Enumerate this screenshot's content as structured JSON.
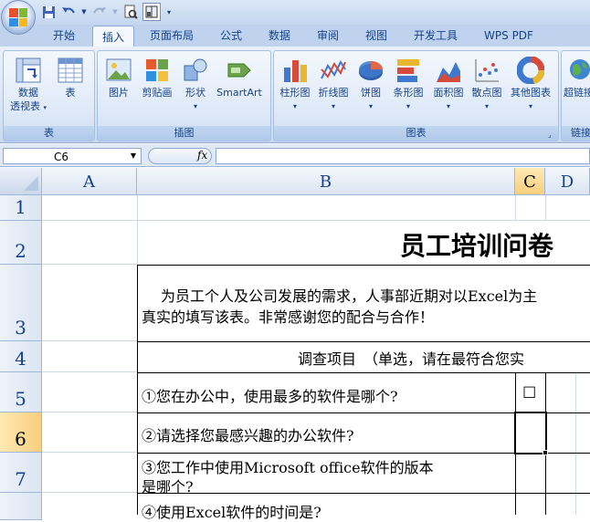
{
  "tabs": [
    {
      "label": "开始",
      "active": false
    },
    {
      "label": "插入",
      "active": true
    },
    {
      "label": "页面布局",
      "active": false
    },
    {
      "label": "公式",
      "active": false
    },
    {
      "label": "数据",
      "active": false
    },
    {
      "label": "审阅",
      "active": false
    },
    {
      "label": "视图",
      "active": false
    },
    {
      "label": "开发工具",
      "active": false
    },
    {
      "label": "WPS PDF",
      "active": false
    }
  ],
  "ribbon": {
    "groups": {
      "table": "表",
      "illustrations": "插图",
      "charts": "图表",
      "links": "链接"
    },
    "buttons": {
      "pivot_line1": "数据",
      "pivot_line2": "透视表",
      "table": "表",
      "picture": "图片",
      "clipart": "剪贴画",
      "shapes": "形状",
      "smartart": "SmartArt",
      "column": "柱形图",
      "line": "折线图",
      "pie": "饼图",
      "bar": "条形图",
      "area": "面积图",
      "scatter": "散点图",
      "other": "其他图表",
      "hyperlink": "超链接"
    }
  },
  "formula_bar": {
    "name_box": "C6",
    "fx": "fx",
    "formula": ""
  },
  "columns": [
    "A",
    "B",
    "C",
    "D"
  ],
  "rows": [
    "1",
    "2",
    "3",
    "4",
    "5",
    "6",
    "7"
  ],
  "cells": {
    "title": "员工培训问卷",
    "intro_line1": "为员工个人及公司发展的需求，人事部近期对以Excel为主",
    "intro_line2": "真实的填写该表。非常感谢您的配合与合作！",
    "survey_header": "调查项目　（单选，请在最符合您实",
    "q1": "①您在办公中，使用最多的软件是哪个?",
    "q1_checkbox": "☐",
    "q2": "②请选择您最感兴趣的办公软件?",
    "q3_line1": "③您工作中使用Microsoft office软件的版本",
    "q3_line2": "是哪个?",
    "q4": "④使用Excel软件的时间是?"
  },
  "colors": {
    "ribbon_text": "#15428b",
    "selected_header": "#f8cf7c",
    "grid_line": "#d0d7e5"
  }
}
